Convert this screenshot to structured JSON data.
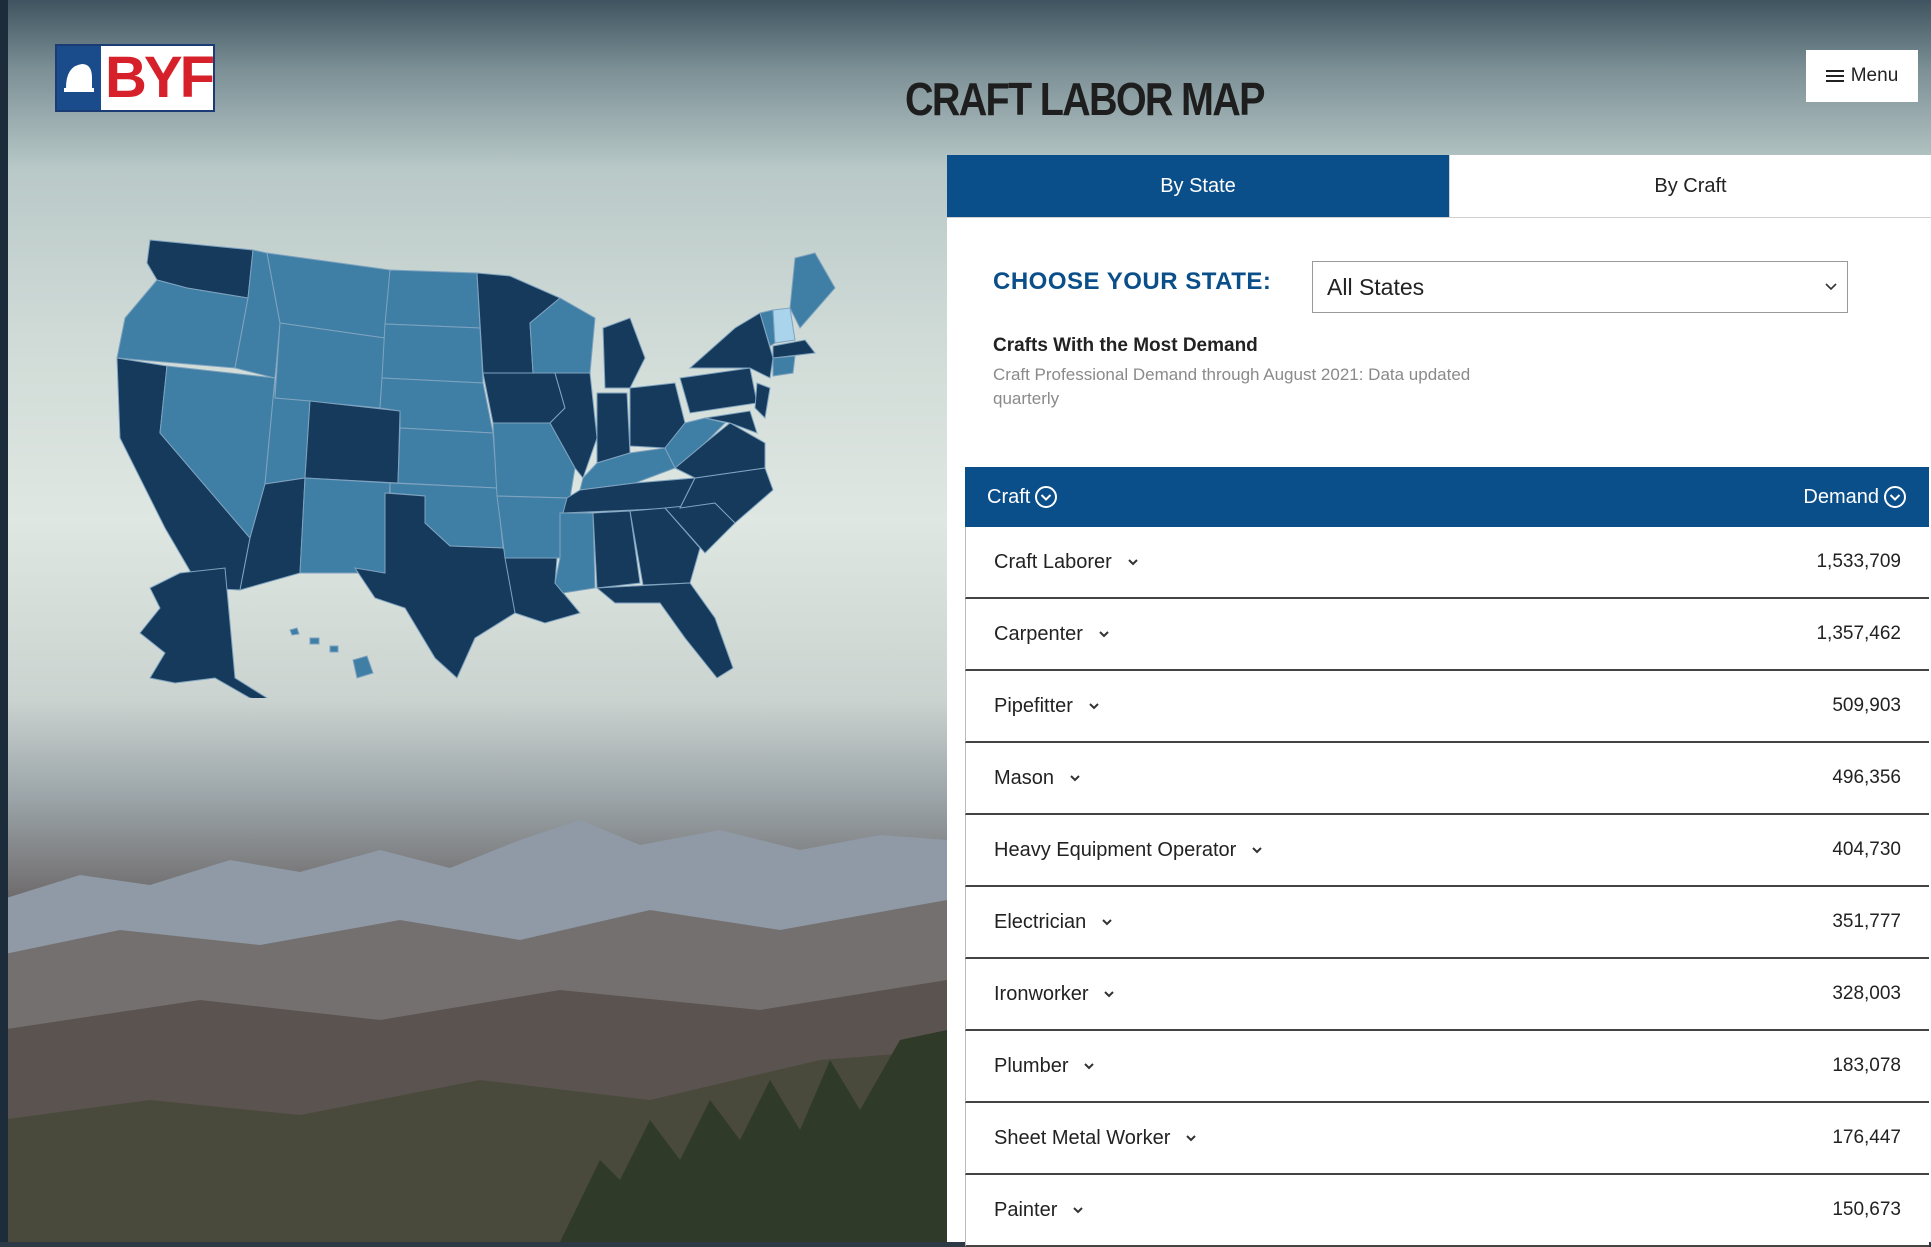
{
  "header": {
    "logo_text": "BYF",
    "page_title": "CRAFT LABOR MAP",
    "menu_label": "Menu"
  },
  "tabs": [
    {
      "label": "By State",
      "active": true
    },
    {
      "label": "By Craft",
      "active": false
    }
  ],
  "state_selector": {
    "label": "CHOOSE YOUR STATE:",
    "selected": "All States"
  },
  "section": {
    "heading": "Crafts With the Most Demand",
    "note": "Craft Professional Demand through August 2021: Data updated quarterly"
  },
  "table": {
    "columns": [
      "Craft",
      "Demand"
    ],
    "rows": [
      {
        "craft": "Craft Laborer",
        "demand": "1,533,709"
      },
      {
        "craft": "Carpenter",
        "demand": "1,357,462"
      },
      {
        "craft": "Pipefitter",
        "demand": "509,903"
      },
      {
        "craft": "Mason",
        "demand": "496,356"
      },
      {
        "craft": "Heavy Equipment Operator",
        "demand": "404,730"
      },
      {
        "craft": "Electrician",
        "demand": "351,777"
      },
      {
        "craft": "Ironworker",
        "demand": "328,003"
      },
      {
        "craft": "Plumber",
        "demand": "183,078"
      },
      {
        "craft": "Sheet Metal Worker",
        "demand": "176,447"
      },
      {
        "craft": "Painter",
        "demand": "150,673"
      }
    ]
  },
  "colors": {
    "brand_blue": "#0b4f8a",
    "map_dark": "#163a5c",
    "map_medium": "#3f7fa6",
    "map_light": "#a9d4ec",
    "logo_red": "#d6202a"
  }
}
